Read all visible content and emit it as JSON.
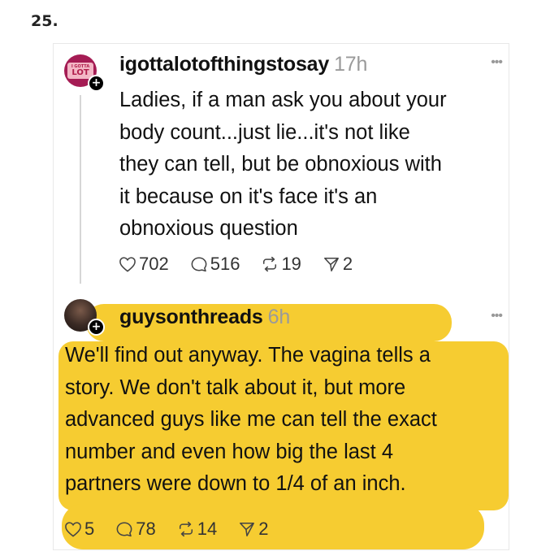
{
  "item_number": "25.",
  "posts": [
    {
      "avatar_text_top": "I GOTTA",
      "avatar_text_bottom": "LOT",
      "badge": "+",
      "username": "igottalotofthingstosay",
      "time": "17h",
      "more": "•••",
      "text": "Ladies, if a man ask you about your\nbody count...just lie...it's not like\nthey can tell, but be obnoxious with\nit because on it's face it's an\nobnoxious question",
      "likes": "702",
      "replies": "516",
      "reposts": "19",
      "shares": "2"
    },
    {
      "badge": "+",
      "username": "guysonthreads",
      "time": "6h",
      "more": "•••",
      "text": "We'll find out anyway. The vagina tells a\nstory. We don't talk about it, but more\nadvanced guys like me can tell the exact\nnumber and even how big the last 4\npartners were down to 1/4 of an inch.",
      "likes": "5",
      "replies": "78",
      "reposts": "14",
      "shares": "2"
    }
  ],
  "icons": {
    "like": "heart-icon",
    "reply": "comment-icon",
    "repost": "repost-icon",
    "share": "send-icon",
    "more": "more-icon"
  },
  "colors": {
    "highlight": "#f6cc31",
    "avatar_brand": "#a51c54",
    "muted_text": "#9a9a9a"
  }
}
